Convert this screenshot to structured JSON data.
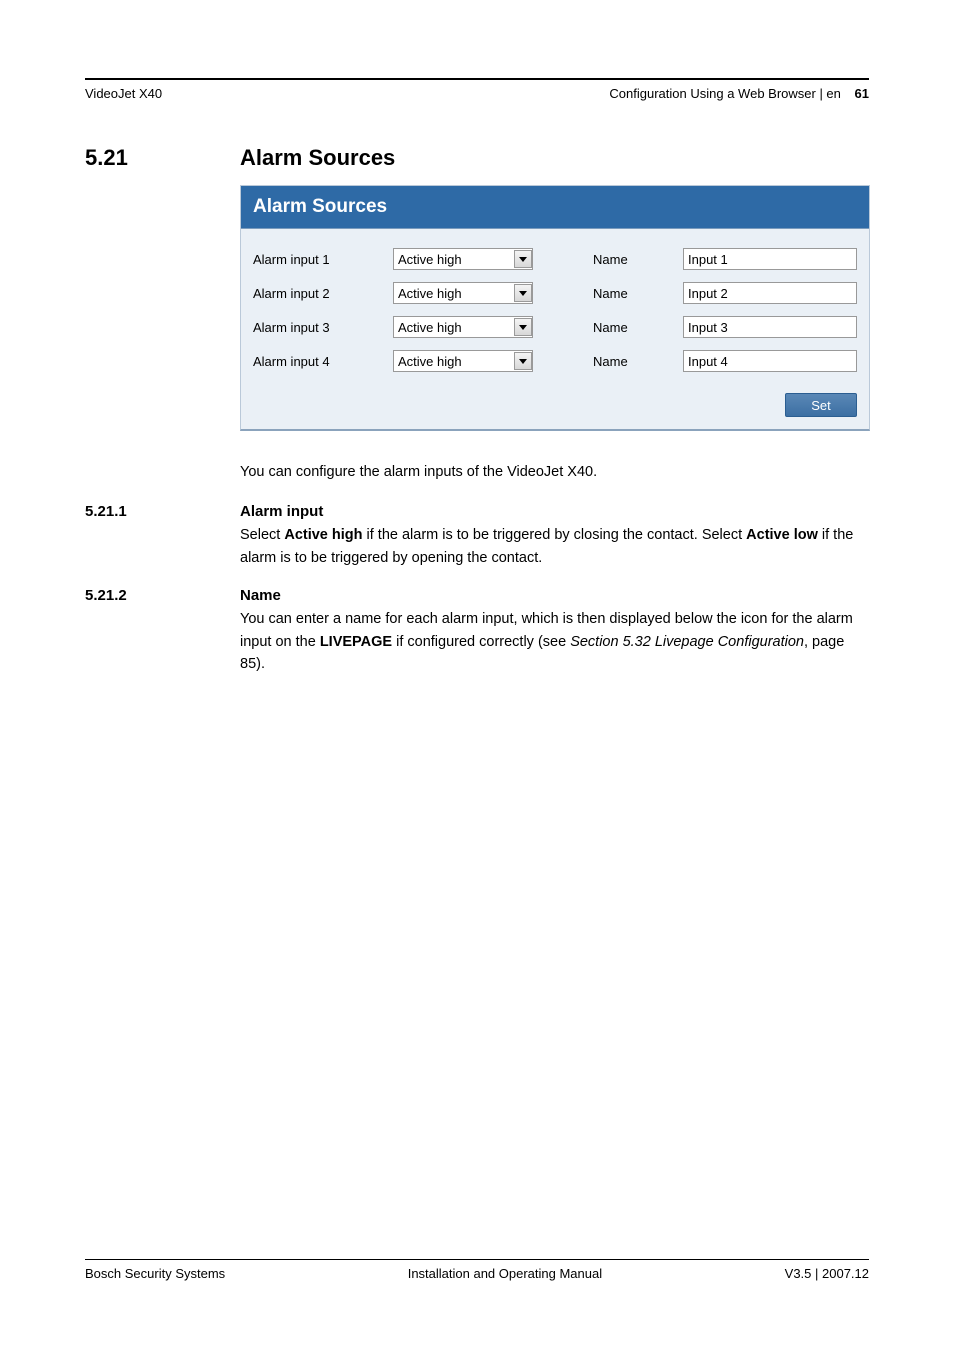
{
  "header": {
    "left": "VideoJet X40",
    "right": "Configuration Using a Web Browser | en",
    "page": "61"
  },
  "section": {
    "num": "5.21",
    "title": "Alarm Sources"
  },
  "panel": {
    "title": "Alarm Sources",
    "rows": [
      {
        "label": "Alarm input 1",
        "select": "Active high",
        "name_label": "Name",
        "value": "Input 1"
      },
      {
        "label": "Alarm input 2",
        "select": "Active high",
        "name_label": "Name",
        "value": "Input 2"
      },
      {
        "label": "Alarm input 3",
        "select": "Active high",
        "name_label": "Name",
        "value": "Input 3"
      },
      {
        "label": "Alarm input 4",
        "select": "Active high",
        "name_label": "Name",
        "value": "Input 4"
      }
    ],
    "set": "Set"
  },
  "intro": "You can configure the alarm inputs of the VideoJet X40.",
  "sub1": {
    "num": "5.21.1",
    "title": "Alarm input",
    "pre": "Select ",
    "b1": "Active high",
    "mid": " if the alarm is to be triggered by closing the contact. Select ",
    "b2": "Active low",
    "post": " if the alarm is to be triggered by opening the contact."
  },
  "sub2": {
    "num": "5.21.2",
    "title": "Name",
    "pre": "You can enter a name for each alarm input, which is then displayed below the icon for the alarm input on the ",
    "b1": "LIVEPAGE",
    "mid": " if configured correctly (see ",
    "i1": "Section 5.32 Livepage Configuration",
    "post": ", page 85)."
  },
  "footer": {
    "left": "Bosch Security Systems",
    "center": "Installation and Operating Manual",
    "right": "V3.5 | 2007.12"
  }
}
